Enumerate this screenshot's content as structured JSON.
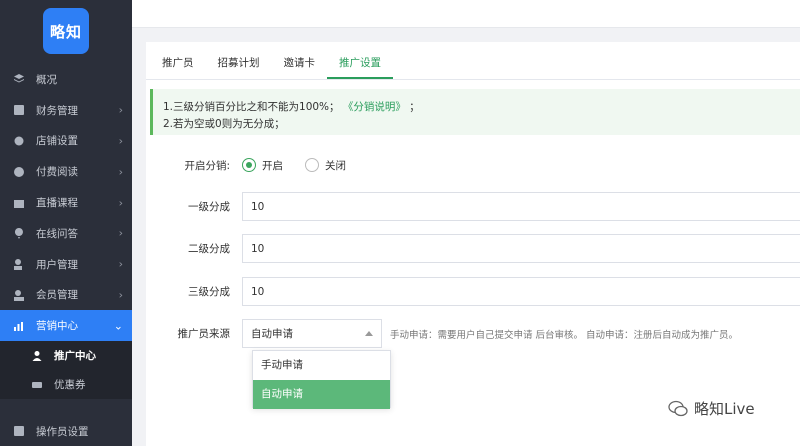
{
  "sidebar": {
    "logo_text": "略知",
    "items": [
      {
        "label": "概况",
        "icon": "layers-icon",
        "has_chevron": false
      },
      {
        "label": "财务管理",
        "icon": "finance-icon",
        "has_chevron": true
      },
      {
        "label": "店铺设置",
        "icon": "gear-icon",
        "has_chevron": true
      },
      {
        "label": "付费阅读",
        "icon": "read-icon",
        "has_chevron": true
      },
      {
        "label": "直播课程",
        "icon": "live-icon",
        "has_chevron": true
      },
      {
        "label": "在线问答",
        "icon": "qa-icon",
        "has_chevron": true
      },
      {
        "label": "用户管理",
        "icon": "user-icon",
        "has_chevron": true
      },
      {
        "label": "会员管理",
        "icon": "member-icon",
        "has_chevron": true
      },
      {
        "label": "营销中心",
        "icon": "chart-icon",
        "has_chevron": true
      }
    ],
    "sub_items": [
      {
        "label": "推广中心",
        "icon": "person-icon"
      },
      {
        "label": "优惠券",
        "icon": "coupon-icon"
      }
    ],
    "bottom_item": {
      "label": "操作员设置",
      "icon": "operator-icon"
    }
  },
  "tabs": [
    "推广员",
    "招募计划",
    "邀请卡",
    "推广设置"
  ],
  "active_tab": "推广设置",
  "notice": {
    "line1_prefix": "1.三级分销百分比之和不能为100%；",
    "line1_link": "《分销说明》",
    "line1_suffix": "；",
    "line2": "2.若为空或0则为无分成；"
  },
  "form": {
    "enable_label": "开启分销:",
    "radio_on": "开启",
    "radio_off": "关闭",
    "level1_label": "一级分成",
    "level1_value": "10",
    "level2_label": "二级分成",
    "level2_value": "10",
    "level3_label": "三级分成",
    "level3_value": "10",
    "source_label": "推广员来源",
    "source_value": "自动申请",
    "source_hint": "手动申请：需要用户自己提交申请 后台审核。 自动申请：注册后自动成为推广员。",
    "source_options": [
      "手动申请",
      "自动申请"
    ]
  },
  "watermark": "略知Live",
  "colors": {
    "accent": "#2e7ff5",
    "green": "#2a9d5c",
    "sidebar_bg": "#2b2f3a"
  }
}
